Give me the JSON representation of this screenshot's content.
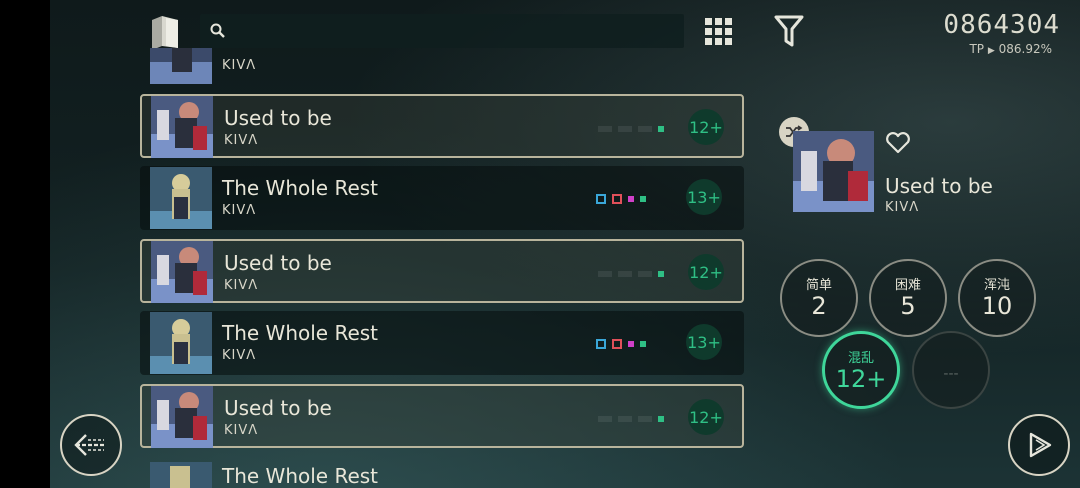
{
  "header": {
    "search": {
      "value": "",
      "placeholder": ""
    },
    "score": "0864304",
    "tp_label": "TP",
    "tp_value": "086.92%"
  },
  "list": {
    "partial_top": {
      "artist": "KIVΛ"
    },
    "items": [
      {
        "title": "Used to be",
        "artist": "KIVΛ",
        "level": "12+",
        "selected": true,
        "art": "used"
      },
      {
        "title": "The Whole Rest",
        "artist": "KIVΛ",
        "level": "13+",
        "selected": false,
        "art": "whole"
      },
      {
        "title": "Used to be",
        "artist": "KIVΛ",
        "level": "12+",
        "selected": true,
        "art": "used"
      },
      {
        "title": "The Whole Rest",
        "artist": "KIVΛ",
        "level": "13+",
        "selected": false,
        "art": "whole"
      },
      {
        "title": "Used to be",
        "artist": "KIVΛ",
        "level": "12+",
        "selected": true,
        "art": "used"
      }
    ],
    "partial_bottom": {
      "title": "The Whole Rest"
    }
  },
  "detail": {
    "title": "Used to be",
    "artist": "KIVΛ",
    "difficulties": [
      {
        "name": "简单",
        "level": "2",
        "state": "normal"
      },
      {
        "name": "困难",
        "level": "5",
        "state": "normal"
      },
      {
        "name": "浑沌",
        "level": "10",
        "state": "normal"
      },
      {
        "name": "混乱",
        "level": "12+",
        "state": "active"
      },
      {
        "name": "",
        "level": "---",
        "state": "empty"
      }
    ]
  },
  "colors": {
    "accent": "#3fd69a",
    "selected_border": "#b8b49c",
    "level_circle_bg": "#0f3a2c",
    "mark_blue": "#3aa7d8",
    "mark_red": "#e0505a",
    "mark_magenta": "#d040c8",
    "mark_green": "#2fbf85"
  },
  "icons": {
    "book": "book-icon",
    "search": "search-icon",
    "grid": "grid-icon",
    "filter": "filter-icon",
    "shuffle": "shuffle-icon",
    "heart": "heart-icon",
    "back": "back-icon",
    "play": "play-icon"
  }
}
